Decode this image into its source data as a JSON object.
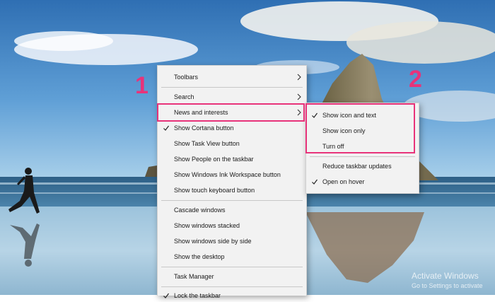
{
  "taskbar_menu": {
    "items": [
      {
        "label": "Toolbars",
        "submenu": true,
        "checked": false
      },
      {
        "label": "Search",
        "submenu": true,
        "checked": false
      },
      {
        "label": "News and interests",
        "submenu": true,
        "checked": false
      },
      {
        "label": "Show Cortana button",
        "submenu": false,
        "checked": true
      },
      {
        "label": "Show Task View button",
        "submenu": false,
        "checked": false
      },
      {
        "label": "Show People on the taskbar",
        "submenu": false,
        "checked": false
      },
      {
        "label": "Show Windows Ink Workspace button",
        "submenu": false,
        "checked": false
      },
      {
        "label": "Show touch keyboard button",
        "submenu": false,
        "checked": false
      },
      {
        "label": "Cascade windows",
        "submenu": false,
        "checked": false
      },
      {
        "label": "Show windows stacked",
        "submenu": false,
        "checked": false
      },
      {
        "label": "Show windows side by side",
        "submenu": false,
        "checked": false
      },
      {
        "label": "Show the desktop",
        "submenu": false,
        "checked": false
      },
      {
        "label": "Task Manager",
        "submenu": false,
        "checked": false
      },
      {
        "label": "Lock the taskbar",
        "submenu": false,
        "checked": true
      }
    ]
  },
  "news_submenu": {
    "items": [
      {
        "label": "Show icon and text",
        "checked": true
      },
      {
        "label": "Show icon only",
        "checked": false
      },
      {
        "label": "Turn off",
        "checked": false
      },
      {
        "label": "Reduce taskbar updates",
        "checked": false
      },
      {
        "label": "Open on hover",
        "checked": true
      }
    ]
  },
  "annotations": {
    "step1": "1",
    "step2": "2",
    "color": "#e8337a"
  },
  "watermark": {
    "line1": "Activate Windows",
    "line2": "Go to Settings to activate"
  }
}
